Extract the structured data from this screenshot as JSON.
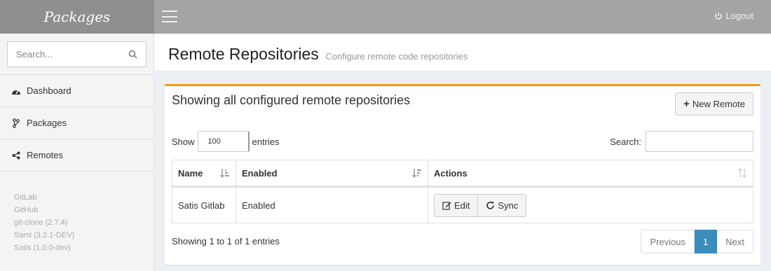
{
  "brand": "Packages",
  "sidebar": {
    "search_placeholder": "Search...",
    "items": [
      {
        "label": "Dashboard",
        "icon": "dashboard-icon"
      },
      {
        "label": "Packages",
        "icon": "branch-icon"
      },
      {
        "label": "Remotes",
        "icon": "share-icon"
      }
    ],
    "versions": [
      "GitLab",
      "GitHub",
      "git-clone (2.7.4)",
      "Sami (3.2.1-DEV)",
      "Satis (1.0.0-dev)"
    ]
  },
  "topbar": {
    "logout_label": "Logout"
  },
  "header": {
    "title": "Remote Repositories",
    "subtitle": "Configure remote code repositories"
  },
  "box": {
    "title": "Showing all configured remote repositories",
    "new_button": "New Remote",
    "length": {
      "show": "Show",
      "value": "100",
      "entries": "entries"
    },
    "search_label": "Search:",
    "columns": [
      "Name",
      "Enabled",
      "Actions"
    ],
    "rows": [
      {
        "name": "Satis Gitlab",
        "enabled": "Enabled",
        "edit": "Edit",
        "sync": "Sync"
      }
    ],
    "info": "Showing 1 to 1 of 1 entries",
    "pagination": {
      "previous": "Previous",
      "current": "1",
      "next": "Next"
    }
  },
  "colors": {
    "accent": "#f39c12",
    "primary": "#3c8dbc",
    "topbar": "#a4a4a4",
    "brand_bg": "#8f8f8f"
  }
}
